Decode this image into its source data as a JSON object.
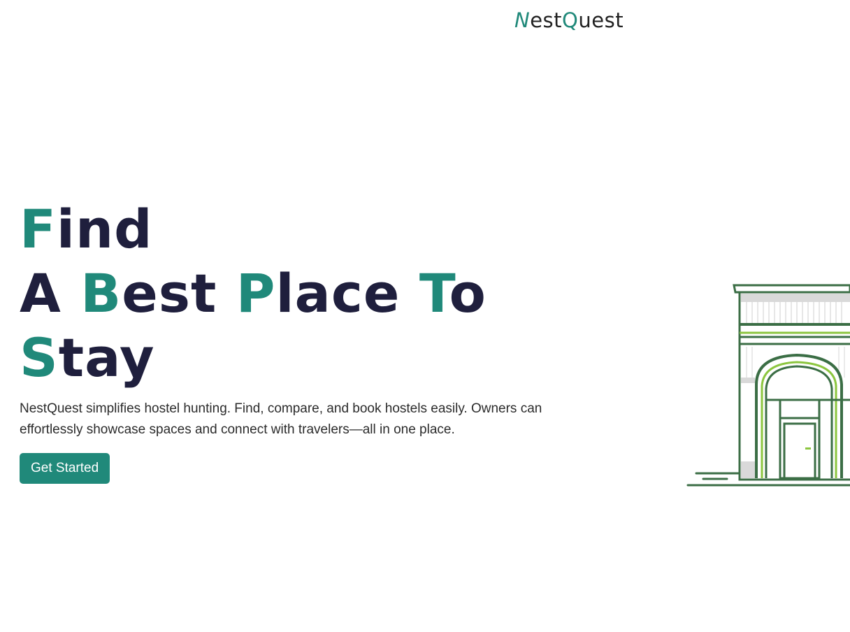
{
  "header": {
    "logo": {
      "first_letter": "N",
      "part2": "est",
      "q_letter": "Q",
      "part3": "uest"
    }
  },
  "hero": {
    "headline": {
      "line1": {
        "accent": "F",
        "rest": "ind"
      },
      "line2": [
        {
          "plain": "A "
        },
        {
          "accent": "B",
          "rest": "est "
        },
        {
          "accent": "P",
          "rest": "lace "
        },
        {
          "accent": "T",
          "rest": "o"
        }
      ],
      "line3": {
        "accent": "S",
        "rest": "tay"
      }
    },
    "description": "NestQuest simplifies hostel hunting. Find, compare, and book hostels easily. Owners can effortlessly showcase spaces and connect with travelers—all in one place.",
    "cta_label": "Get Started"
  },
  "colors": {
    "accent": "#20897a",
    "headline_dark": "#1f1f3d",
    "illustration_green": "#3b6e45",
    "illustration_lime": "#8cc63f"
  },
  "illustration": {
    "icon": "hostel-building-icon"
  }
}
